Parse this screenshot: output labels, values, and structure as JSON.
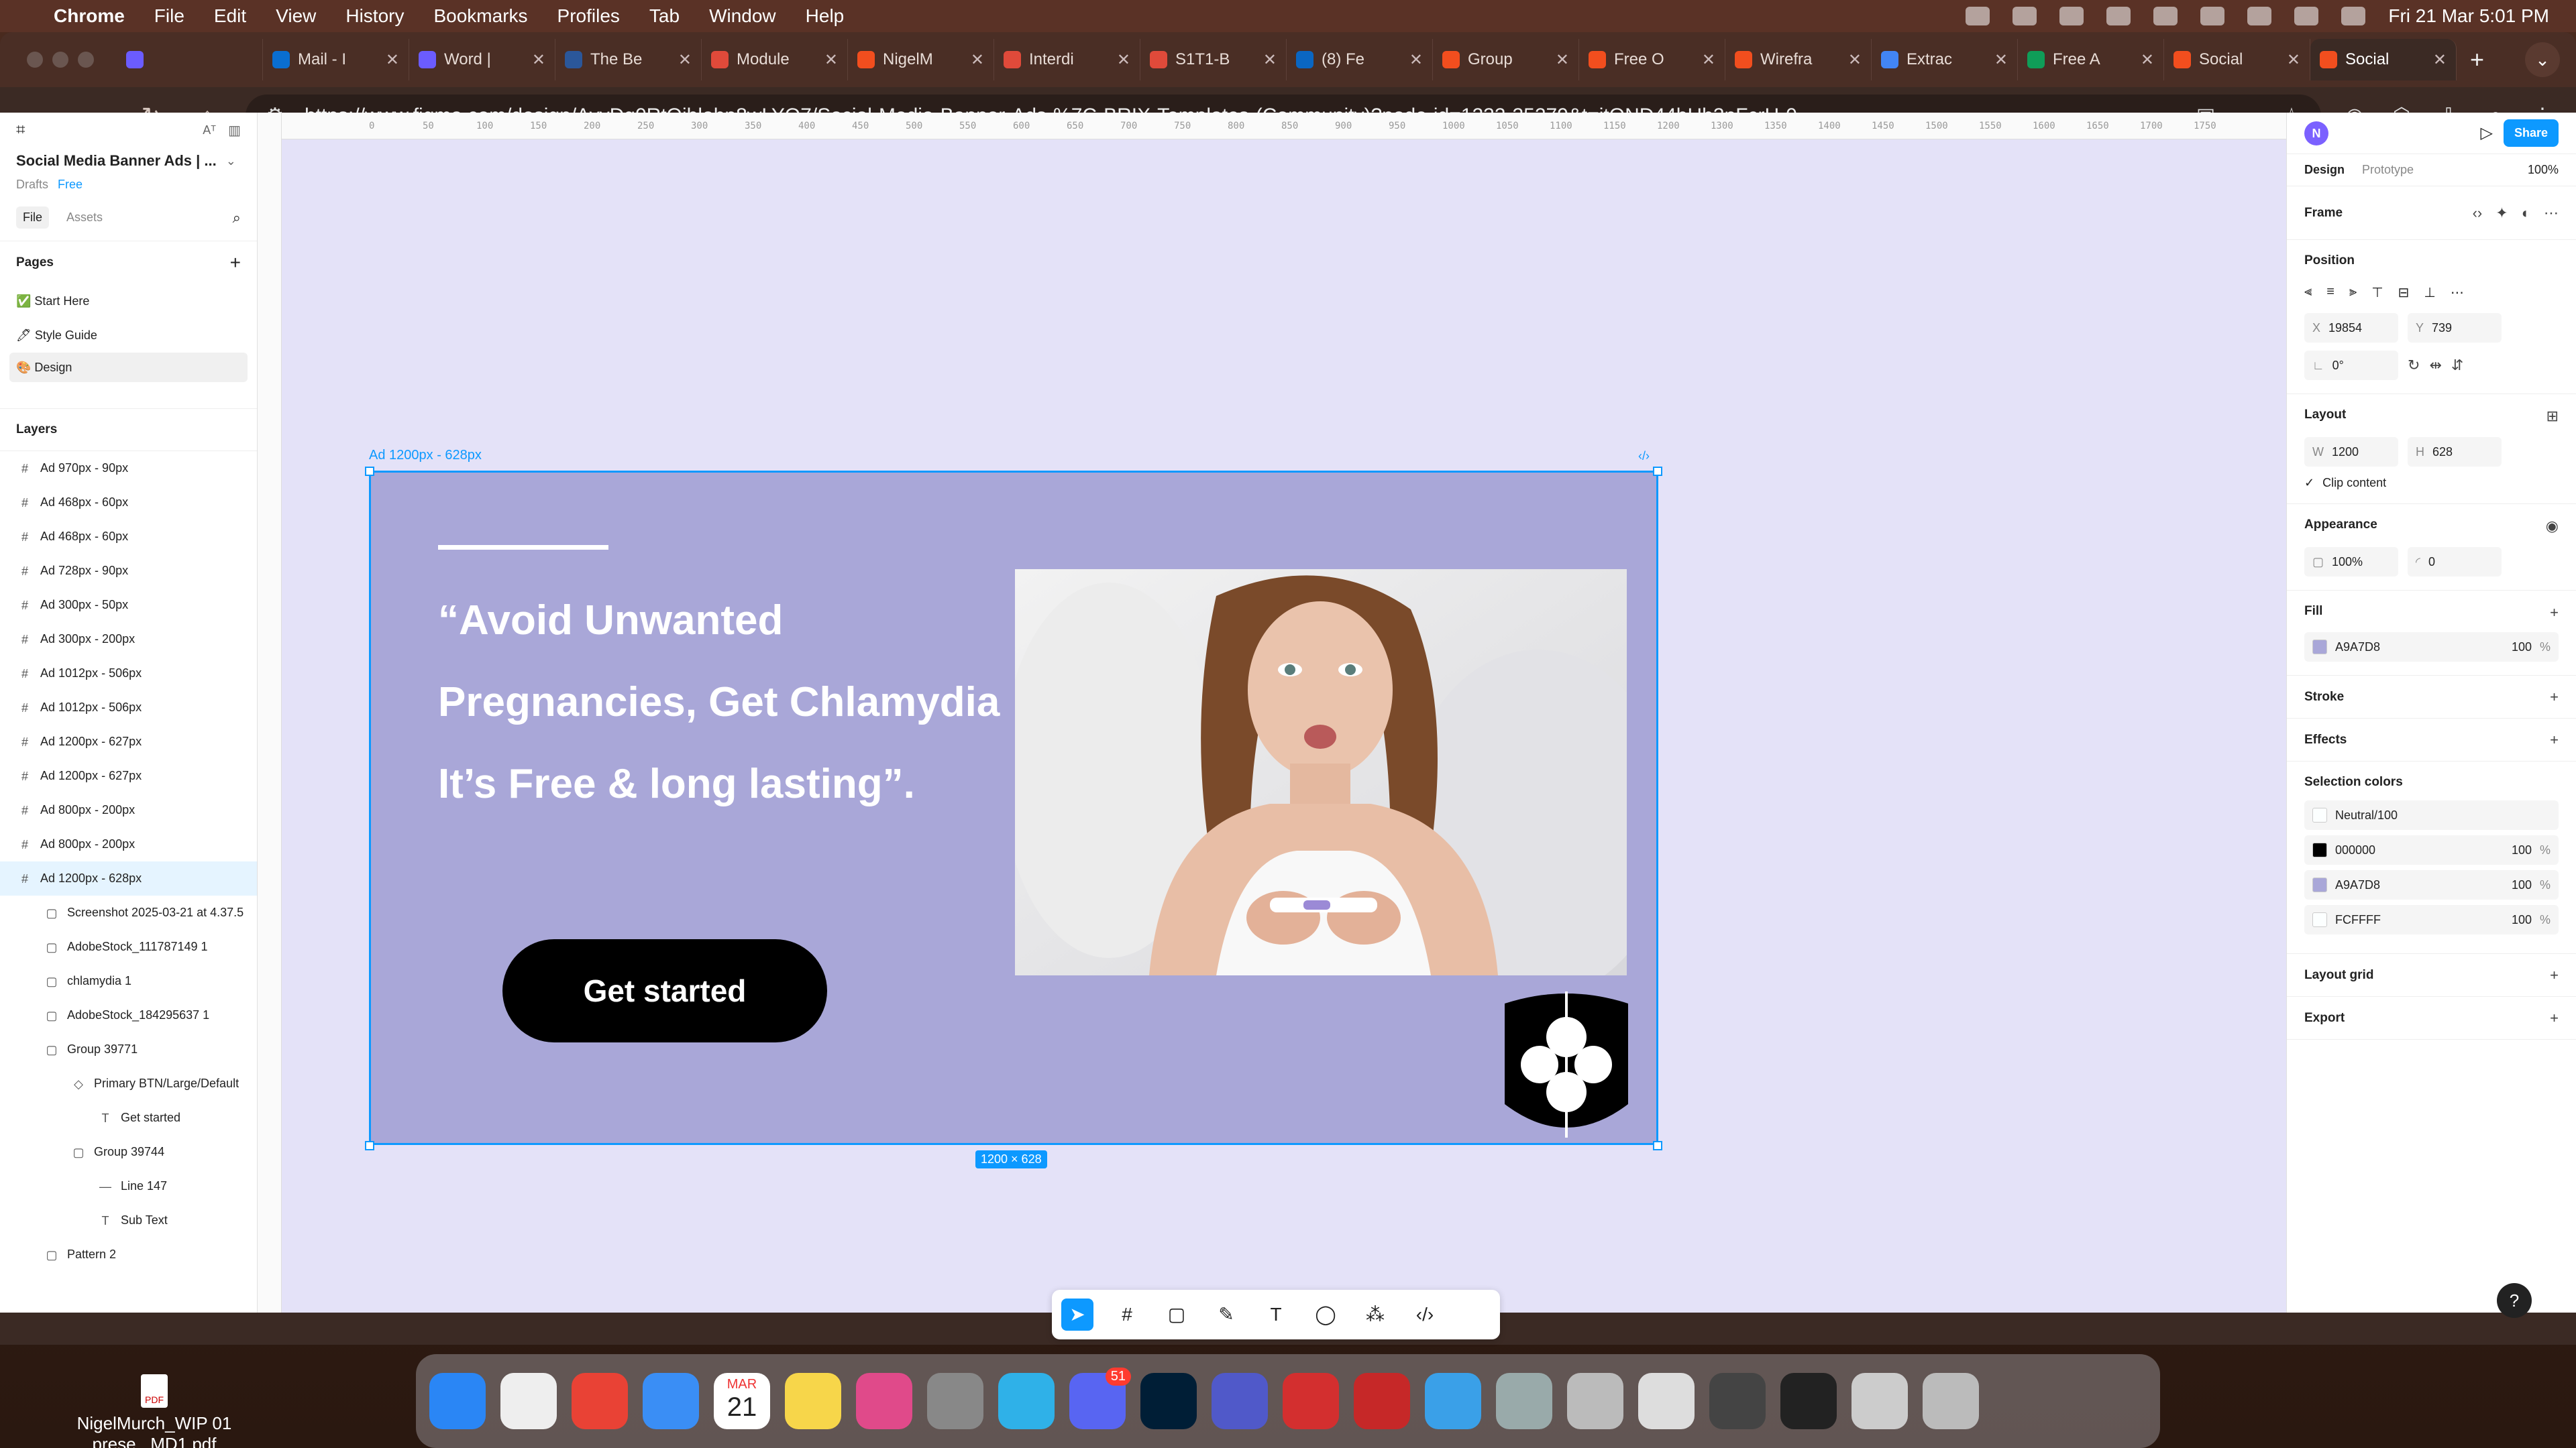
{
  "menubar": {
    "app_name": "Chrome",
    "items": [
      "File",
      "Edit",
      "View",
      "History",
      "Bookmarks",
      "Profiles",
      "Tab",
      "Window",
      "Help"
    ],
    "datetime": "Fri 21 Mar  5:01 PM"
  },
  "tabs": [
    {
      "label": "",
      "color": "#6b5cff"
    },
    {
      "label": "Mail - I",
      "color": "#0a6ed1"
    },
    {
      "label": "Word |",
      "color": "#6b5cff"
    },
    {
      "label": "The Be",
      "color": "#2b579a"
    },
    {
      "label": "Module",
      "color": "#e04a3a"
    },
    {
      "label": "NigelM",
      "color": "#f24e1e"
    },
    {
      "label": "Interdi",
      "color": "#e04a3a"
    },
    {
      "label": "S1T1-B",
      "color": "#e04a3a"
    },
    {
      "label": "(8) Fe",
      "color": "#0a66c2"
    },
    {
      "label": "Group",
      "color": "#f24e1e"
    },
    {
      "label": "Free O",
      "color": "#f24e1e"
    },
    {
      "label": "Wirefra",
      "color": "#f24e1e"
    },
    {
      "label": "Extrac",
      "color": "#4285f4"
    },
    {
      "label": "Free A",
      "color": "#0f9d58"
    },
    {
      "label": "Social",
      "color": "#f24e1e"
    },
    {
      "label": "Social",
      "color": "#f24e1e",
      "active": true
    }
  ],
  "url": "https://www.figma.com/design/AvyDq0RtOiblohp8wLYQ7/Social-Media-Banner-Ads-%7C-BRIX-Templates-(Community)?node-id=1232-35279&t=itOND44bHh3nFcrH-0",
  "figma": {
    "file_title": "Social Media Banner Ads | ...",
    "drafts": "Drafts",
    "plan": "Free",
    "left_tabs": {
      "file": "File",
      "assets": "Assets"
    },
    "pages_heading": "Pages",
    "pages": [
      "✅ Start Here",
      "🖊 Style Guide",
      "🎨 Design"
    ],
    "layers_heading": "Layers",
    "layers": [
      {
        "label": "Ad 970px - 90px",
        "depth": 0,
        "icon": "#"
      },
      {
        "label": "Ad 468px - 60px",
        "depth": 0,
        "icon": "#"
      },
      {
        "label": "Ad 468px - 60px",
        "depth": 0,
        "icon": "#"
      },
      {
        "label": "Ad 728px - 90px",
        "depth": 0,
        "icon": "#"
      },
      {
        "label": "Ad 300px - 50px",
        "depth": 0,
        "icon": "#"
      },
      {
        "label": "Ad 300px - 200px",
        "depth": 0,
        "icon": "#"
      },
      {
        "label": "Ad 1012px - 506px",
        "depth": 0,
        "icon": "#"
      },
      {
        "label": "Ad 1012px - 506px",
        "depth": 0,
        "icon": "#"
      },
      {
        "label": "Ad 1200px - 627px",
        "depth": 0,
        "icon": "#"
      },
      {
        "label": "Ad 1200px - 627px",
        "depth": 0,
        "icon": "#"
      },
      {
        "label": "Ad 800px - 200px",
        "depth": 0,
        "icon": "#"
      },
      {
        "label": "Ad 800px - 200px",
        "depth": 0,
        "icon": "#"
      },
      {
        "label": "Ad 1200px - 628px",
        "depth": 0,
        "icon": "#",
        "selected": true
      },
      {
        "label": "Screenshot 2025-03-21 at 4.37.5",
        "depth": 1,
        "icon": "▢"
      },
      {
        "label": "AdobeStock_111787149 1",
        "depth": 1,
        "icon": "▢"
      },
      {
        "label": "chlamydia 1",
        "depth": 1,
        "icon": "▢"
      },
      {
        "label": "AdobeStock_184295637 1",
        "depth": 1,
        "icon": "▢"
      },
      {
        "label": "Group 39771",
        "depth": 1,
        "icon": "▢"
      },
      {
        "label": "Primary BTN/Large/Default",
        "depth": 2,
        "icon": "◇"
      },
      {
        "label": "Get started",
        "depth": 3,
        "icon": "T"
      },
      {
        "label": "Group 39744",
        "depth": 2,
        "icon": "▢"
      },
      {
        "label": "Line 147",
        "depth": 3,
        "icon": "—"
      },
      {
        "label": "Sub Text",
        "depth": 3,
        "icon": "T"
      },
      {
        "label": "Pattern 2",
        "depth": 1,
        "icon": "▢"
      }
    ],
    "ruler_ticks": [
      "0",
      "50",
      "100",
      "150",
      "200",
      "250",
      "300",
      "350",
      "400",
      "450",
      "500",
      "550",
      "600",
      "650",
      "700",
      "750",
      "800",
      "850",
      "900",
      "950",
      "1000",
      "1050",
      "1100",
      "1150",
      "1200",
      "1300",
      "1350",
      "1400",
      "1450",
      "1500",
      "1550",
      "1600",
      "1650",
      "1700",
      "1750"
    ],
    "banner": {
      "frame_label": "Ad 1200px - 628px",
      "headline": "“Avoid Unwanted Pregnancies, Get Chlamydia It’s Free & long lasting”.",
      "cta": "Get started",
      "size_badge": "1200 × 628",
      "bg_color": "#A9A7D8"
    },
    "right": {
      "avatar": "N",
      "share": "Share",
      "tabs": {
        "design": "Design",
        "prototype": "Prototype"
      },
      "zoom": "100%",
      "frame_label": "Frame",
      "position_heading": "Position",
      "x": "19854",
      "y": "739",
      "rotation": "0°",
      "layout_heading": "Layout",
      "w": "1200",
      "h": "628",
      "clip_content": "Clip content",
      "appearance_heading": "Appearance",
      "opacity": "100%",
      "radius": "0",
      "fill_heading": "Fill",
      "fill_hex": "A9A7D8",
      "fill_opacity": "100",
      "stroke_heading": "Stroke",
      "effects_heading": "Effects",
      "selection_colors_heading": "Selection colors",
      "selection_colors": [
        {
          "hex": "Neutral/100",
          "opacity": "",
          "color": "#FCFFFF"
        },
        {
          "hex": "000000",
          "opacity": "100",
          "color": "#000000"
        },
        {
          "hex": "A9A7D8",
          "opacity": "100",
          "color": "#A9A7D8"
        },
        {
          "hex": "FCFFFF",
          "opacity": "100",
          "color": "#FCFFFF"
        }
      ],
      "layout_grid_heading": "Layout grid",
      "export_heading": "Export",
      "percent": "%"
    }
  },
  "dock": {
    "discord_badge": "51",
    "calendar_month": "MAR",
    "calendar_day": "21"
  },
  "desktop_file": "NigelMurch_WIP 01 prese...MD1.pdf"
}
